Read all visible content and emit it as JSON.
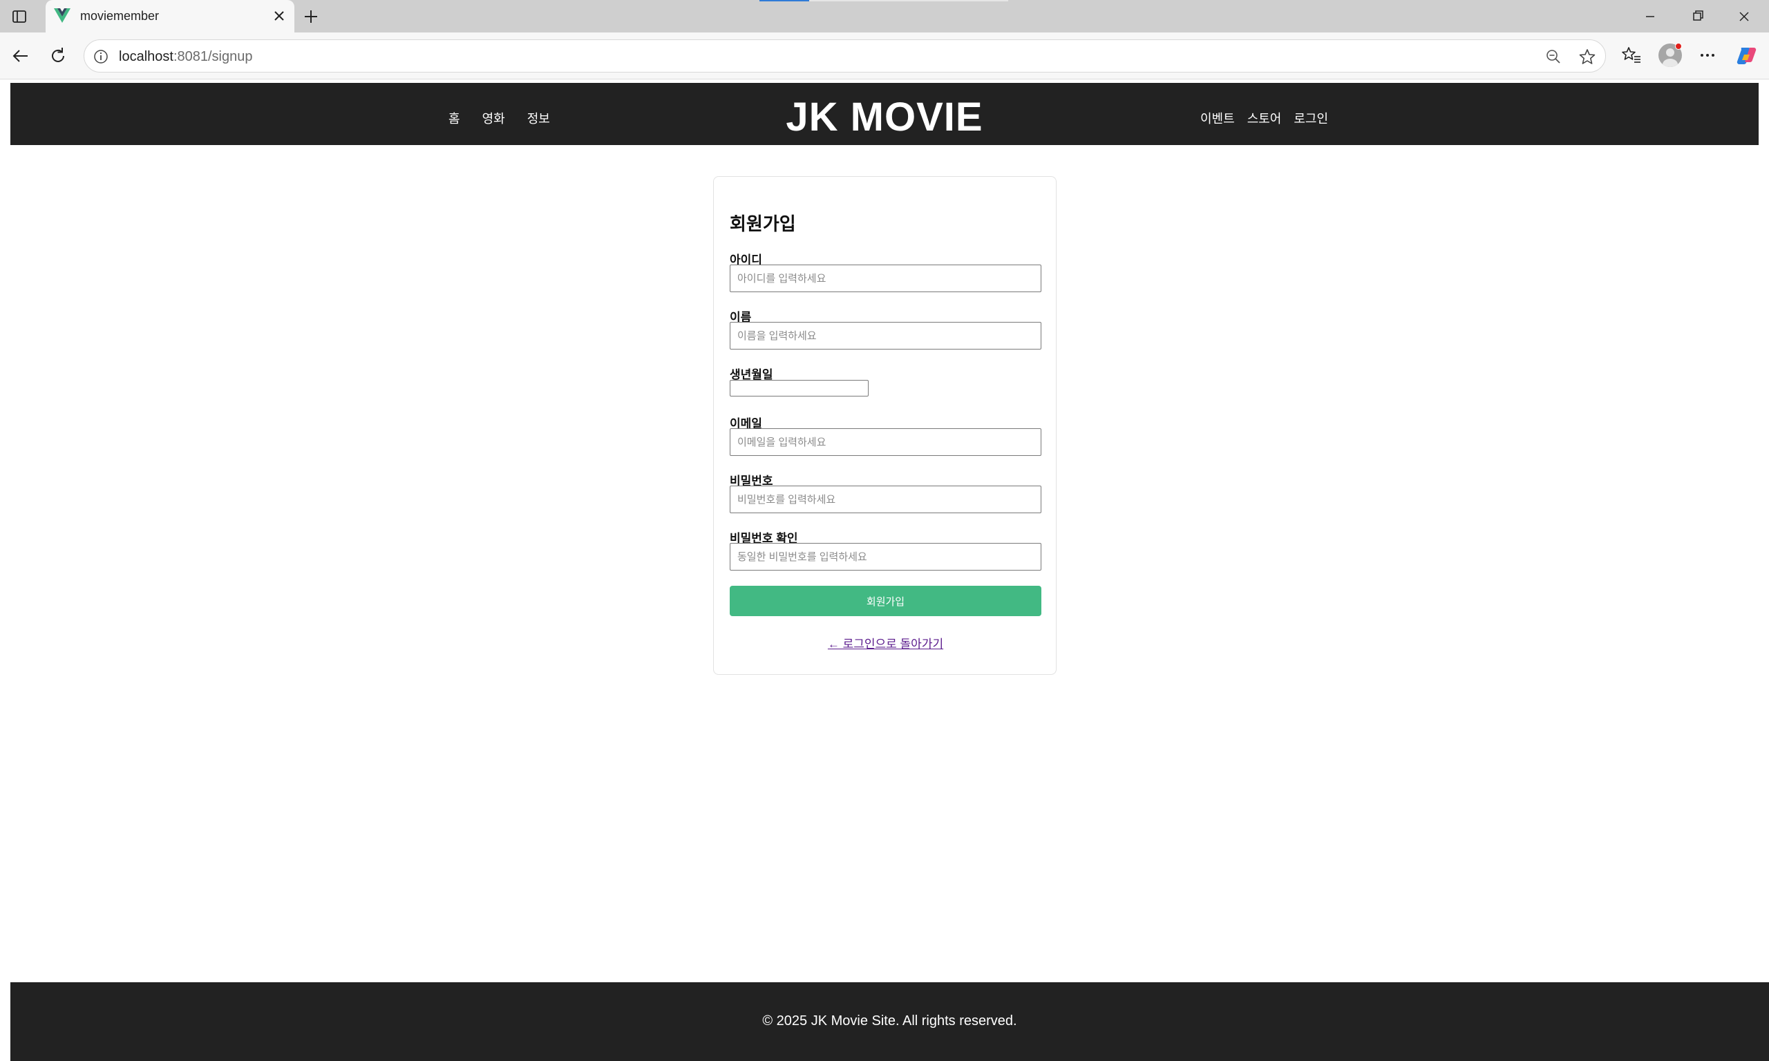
{
  "browser": {
    "tab_title": "moviemember",
    "url_host": "localhost",
    "url_rest": ":8081/signup"
  },
  "header": {
    "logo": "JK MOVIE",
    "nav_left": [
      "홈",
      "영화",
      "정보"
    ],
    "nav_right": [
      "이벤트",
      "스토어",
      "로그인"
    ]
  },
  "signup": {
    "title": "회원가입",
    "fields": {
      "id": {
        "label": "아이디",
        "placeholder": "아이디를 입력하세요"
      },
      "name": {
        "label": "이름",
        "placeholder": "이름을 입력하세요"
      },
      "birth": {
        "label": "생년월일"
      },
      "email": {
        "label": "이메일",
        "placeholder": "이메일을 입력하세요"
      },
      "password": {
        "label": "비밀번호",
        "placeholder": "비밀번호를 입력하세요"
      },
      "password_confirm": {
        "label": "비밀번호 확인",
        "placeholder": "동일한 비밀번호를 입력하세요"
      }
    },
    "submit_label": "회원가입",
    "back_link": "← 로그인으로 돌아가기"
  },
  "footer": {
    "text": "© 2025 JK Movie Site. All rights reserved."
  },
  "colors": {
    "header_bg": "#222222",
    "accent": "#42b983",
    "link": "#5a1a8c"
  },
  "icons": [
    "sidebar-icon",
    "vue-logo-icon",
    "close-icon",
    "plus-icon",
    "minimize-icon",
    "restore-icon",
    "back-icon",
    "reload-icon",
    "info-icon",
    "zoom-out-icon",
    "star-icon",
    "favorites-icon",
    "avatar",
    "more-icon",
    "copilot-icon"
  ]
}
